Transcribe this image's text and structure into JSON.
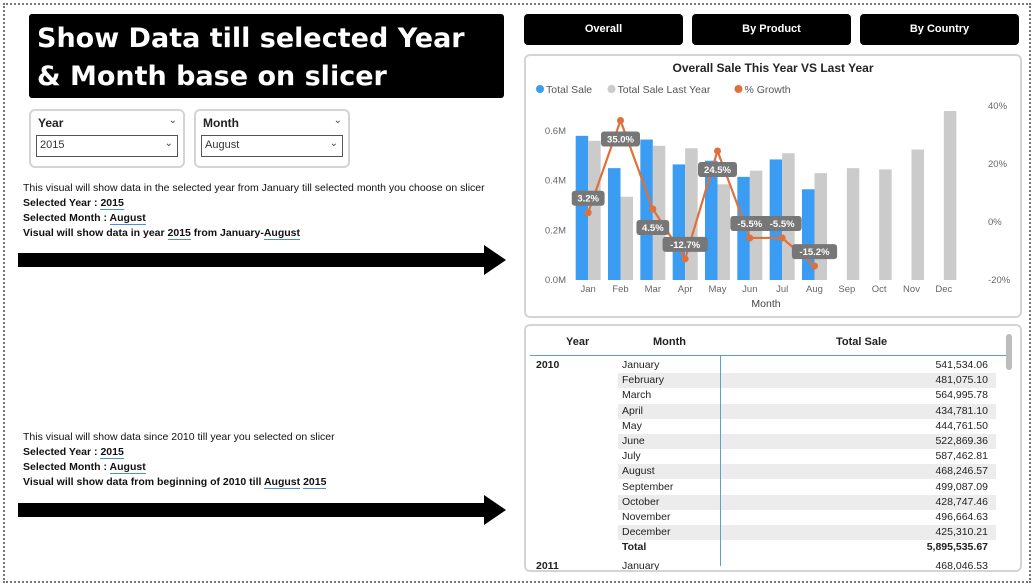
{
  "title": "Show Data till selected Year & Month base on slicer",
  "slicers": {
    "year": {
      "label": "Year",
      "value": "2015"
    },
    "month": {
      "label": "Month",
      "value": "August"
    }
  },
  "info1": {
    "desc": "This visual will show data in the selected year from January till selected month you choose on slicer",
    "year_label": "Selected Year : ",
    "year_value": "2015",
    "month_label": "Selected Month : ",
    "month_value": "August",
    "summary_prefix": "Visual will show data in year ",
    "summary_year": "2015",
    "summary_mid": " from January-",
    "summary_month": "August"
  },
  "info2": {
    "desc": "This visual will show data since 2010 till year you selected on slicer",
    "year_label": "Selected Year : ",
    "year_value": "2015",
    "month_label": "Selected Month : ",
    "month_value": "August",
    "summary_prefix": "Visual will show data from beginning of 2010 till ",
    "summary_month": "August",
    "summary_year": "2015"
  },
  "nav": {
    "overall": "Overall",
    "by_product": "By Product",
    "by_country": "By Country"
  },
  "chart_data": {
    "type": "bar",
    "title": "Overall Sale This Year VS Last Year",
    "xlabel": "Month",
    "categories": [
      "Jan",
      "Feb",
      "Mar",
      "Apr",
      "May",
      "Jun",
      "Jul",
      "Aug",
      "Sep",
      "Oct",
      "Nov",
      "Dec"
    ],
    "series": [
      {
        "name": "Total Sale",
        "color": "#3a9cf2",
        "values": [
          0.58,
          0.45,
          0.565,
          0.465,
          0.48,
          0.415,
          0.485,
          0.365,
          null,
          null,
          null,
          null
        ]
      },
      {
        "name": "Total Sale Last Year",
        "color": "#cbcbcb",
        "values": [
          0.56,
          0.335,
          0.54,
          0.53,
          0.385,
          0.44,
          0.51,
          0.43,
          0.45,
          0.445,
          0.525,
          0.68
        ]
      },
      {
        "name": "% Growth",
        "color": "#e0703a",
        "type": "line",
        "axis": "right",
        "values": [
          3.2,
          35.0,
          4.5,
          -12.7,
          24.5,
          -5.5,
          -5.5,
          -15.2
        ],
        "labels": [
          "3.2%",
          "35.0%",
          "4.5%",
          "-12.7%",
          "24.5%",
          "-5.5%",
          "-5.5%",
          "-15.2%"
        ]
      }
    ],
    "y_left": {
      "ticks": [
        "0.0M",
        "0.2M",
        "0.4M",
        "0.6M"
      ],
      "range": [
        0,
        0.7
      ]
    },
    "y_right": {
      "ticks": [
        "-20%",
        "0%",
        "20%",
        "40%"
      ],
      "range": [
        -20,
        40
      ]
    },
    "legend": "top-left",
    "grid": false
  },
  "table": {
    "headers": {
      "year": "Year",
      "month": "Month",
      "total": "Total Sale"
    },
    "years": [
      "2010",
      "2011"
    ],
    "rows": [
      {
        "month": "January",
        "value": "541,534.06"
      },
      {
        "month": "February",
        "value": "481,075.10"
      },
      {
        "month": "March",
        "value": "564,995.78"
      },
      {
        "month": "April",
        "value": "434,781.10"
      },
      {
        "month": "May",
        "value": "444,761.50"
      },
      {
        "month": "June",
        "value": "522,869.36"
      },
      {
        "month": "July",
        "value": "587,462.81"
      },
      {
        "month": "August",
        "value": "468,246.57"
      },
      {
        "month": "September",
        "value": "499,087.09"
      },
      {
        "month": "October",
        "value": "428,747.46"
      },
      {
        "month": "November",
        "value": "496,664.63"
      },
      {
        "month": "December",
        "value": "425,310.21"
      }
    ],
    "total": {
      "label": "Total",
      "value": "5,895,535.67"
    },
    "partial": {
      "month": "January",
      "value": "468,046.53"
    }
  }
}
